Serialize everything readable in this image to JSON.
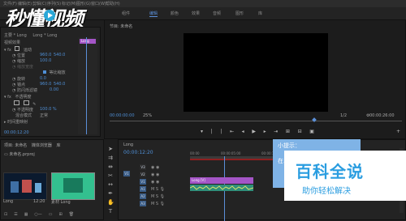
{
  "watermark_top": {
    "text": "秒懂视频"
  },
  "menu": [
    "文件(F)",
    "编辑(E)",
    "剪辑(C)",
    "序列(S)",
    "标记(M)",
    "图形(G)",
    "窗口(W)",
    "帮助(H)"
  ],
  "workspaces": [
    {
      "label": "组件",
      "active": false
    },
    {
      "label": "编辑",
      "active": true
    },
    {
      "label": "颜色",
      "active": false
    },
    {
      "label": "效果",
      "active": false
    },
    {
      "label": "音频",
      "active": false
    },
    {
      "label": "图形",
      "active": false
    },
    {
      "label": "库",
      "active": false
    }
  ],
  "effect_controls": {
    "header": "主要 * Long",
    "clip_path": "Long * Long",
    "section_video": "视频效果",
    "motion": "运动",
    "position": {
      "label": "位置",
      "x": "960.0",
      "y": "540.0"
    },
    "scale": {
      "label": "缩放",
      "value": "100.0"
    },
    "scale_width": {
      "label": "缩放宽度",
      "value": ""
    },
    "uniform_scale": "等比缩放",
    "rotation": {
      "label": "旋转",
      "value": "0.0"
    },
    "anchor": {
      "label": "锚点",
      "x": "960.0",
      "y": "540.0"
    },
    "anti_flicker": {
      "label": "防闪烁滤镜",
      "value": "0.00"
    },
    "opacity": "不透明度",
    "opacity_value": {
      "label": "不透明度",
      "value": "100.0 %"
    },
    "blend_mode": {
      "label": "混合模式",
      "value": "正常"
    },
    "time_remap": "时间重映射",
    "clip_label": "Long",
    "timecode": "00:00:12:20"
  },
  "program": {
    "title": "节目: 未命名",
    "timecode_left": "00:00:00:00",
    "zoom": "25%",
    "resolution": "1/2",
    "timecode_right": "00:00:26:00"
  },
  "project": {
    "tabs": [
      "项目: 未命名",
      "媒体浏览器",
      "库"
    ],
    "folder": "未命名.prproj",
    "items": [
      {
        "name": "Long",
        "duration": "12:20"
      },
      {
        "name": "素材 Long",
        "duration": ""
      }
    ]
  },
  "timeline": {
    "tab": "Long",
    "timecode": "00:00:12:20",
    "ruler": [
      "00:00",
      "00:00:05:00",
      "00:00:10:00"
    ],
    "tracks": [
      "V3",
      "V2",
      "V1",
      "A1",
      "A2",
      "A3"
    ],
    "clip_label": "Long [V]"
  },
  "tooltip": {
    "title": "小提示：",
    "body": "在..."
  },
  "watermark_bottom": {
    "title": "百科全说",
    "subtitle": "助你轻松解决"
  }
}
